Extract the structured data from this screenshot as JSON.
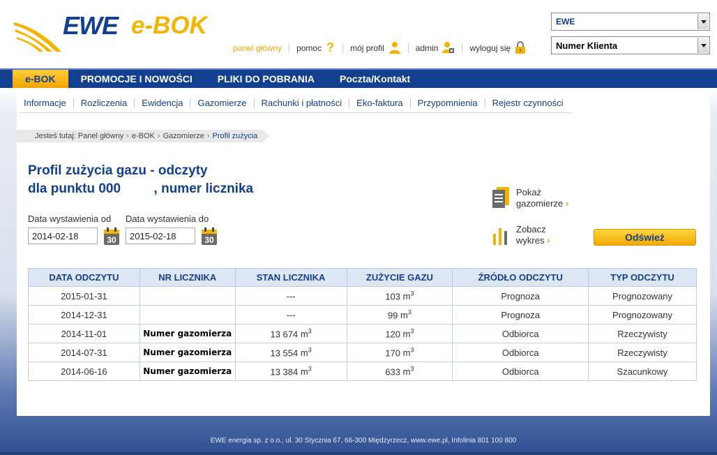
{
  "brand": {
    "name": "EWE",
    "product": "e-BOK"
  },
  "toplinks": [
    {
      "label": "panel główny"
    },
    {
      "label": "pomoc"
    },
    {
      "label": "mój profil"
    },
    {
      "label": "admin"
    },
    {
      "label": "wyloguj się"
    }
  ],
  "selects": {
    "company": "EWE",
    "client": "Numer Klienta"
  },
  "mainnav": [
    "e-BOK",
    "PROMOCJE I NOWOŚCI",
    "PLIKI DO POBRANIA",
    "Poczta/Kontakt"
  ],
  "subnav": [
    "Informacje",
    "Rozliczenia",
    "Ewidencja",
    "Gazomierze",
    "Rachunki i płatności",
    "Eko-faktura",
    "Przypomnienia",
    "Rejestr czynności"
  ],
  "breadcrumb": {
    "prefix": "Jesteś tutaj:",
    "items": [
      "Panel główny",
      "e-BOK",
      "Gazomierze"
    ],
    "current": "Profil zużycia"
  },
  "title": {
    "line1": "Profil zużycia gazu - odczyty",
    "line2": "dla punktu 000         , numer licznika"
  },
  "filters": {
    "from_label": "Data wystawienia od",
    "from_value": "2014-02-18",
    "to_label": "Data wystawienia do",
    "to_value": "2015-02-18",
    "calendar_day": "30"
  },
  "side_links": {
    "show": {
      "line1": "Pokaż",
      "line2": "gazomierze"
    },
    "chart": {
      "line1": "Zobacz",
      "line2": "wykres"
    }
  },
  "refresh_label": "Odśwież",
  "table": {
    "headers": [
      "DATA ODCZYTU",
      "NR LICZNIKA",
      "STAN LICZNIKA",
      "ZUŻYCIE GAZU",
      "ŹRÓDŁO ODCZYTU",
      "TYP ODCZYTU"
    ],
    "unit": "m",
    "unit_exp": "3",
    "rows": [
      {
        "date": "2015-01-31",
        "meter": "",
        "state": "---",
        "state_unit": false,
        "usage": "103",
        "source": "Prognoza",
        "type": "Prognozowany"
      },
      {
        "date": "2014-12-31",
        "meter": "",
        "state": "---",
        "state_unit": false,
        "usage": "99",
        "source": "Prognoza",
        "type": "Prognozowany"
      },
      {
        "date": "2014-11-01",
        "meter": "Numer gazomierza",
        "state": "13 674",
        "state_unit": true,
        "usage": "120",
        "source": "Odbiorca",
        "type": "Rzeczywisty"
      },
      {
        "date": "2014-07-31",
        "meter": "Numer gazomierza",
        "state": "13 554",
        "state_unit": true,
        "usage": "170",
        "source": "Odbiorca",
        "type": "Rzeczywisty"
      },
      {
        "date": "2014-06-16",
        "meter": "Numer gazomierza",
        "state": "13 384",
        "state_unit": true,
        "usage": "633",
        "source": "Odbiorca",
        "type": "Szacunkowy"
      }
    ]
  },
  "footer": "EWE energia sp. z o.o., ul. 30 Stycznia 67, 66-300 Międzyrzecz, www.ewe.pl, Infolinia 801 100 800",
  "icons": {
    "help": "question-icon",
    "profile": "user-icon",
    "admin": "admin-user-icon",
    "logout": "lock-icon",
    "gas_meters": "document-list-icon",
    "chart": "bar-chart-icon",
    "calendar": "calendar-icon"
  },
  "colors": {
    "brand_blue": "#12408e",
    "brand_yellow": "#f4b400"
  }
}
